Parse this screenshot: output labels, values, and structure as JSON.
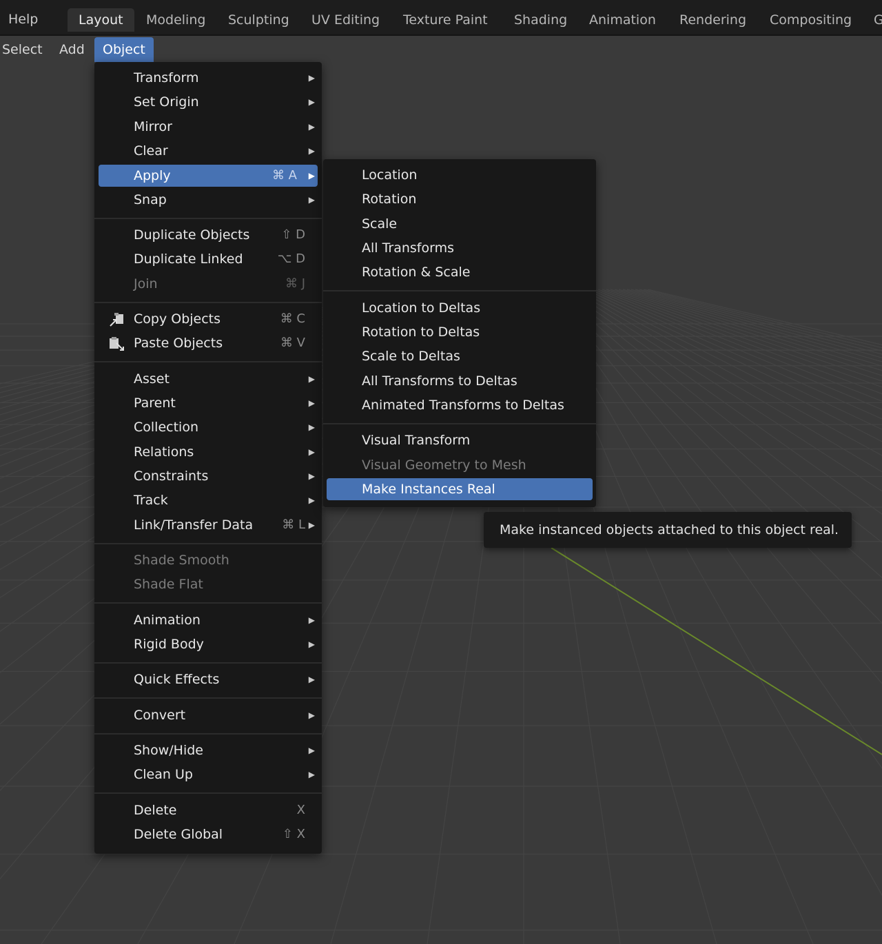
{
  "topbar": {
    "help": "Help",
    "tabs": [
      "Layout",
      "Modeling",
      "Sculpting",
      "UV Editing",
      "Texture Paint",
      "Shading",
      "Animation",
      "Rendering",
      "Compositing",
      "G"
    ]
  },
  "menubar": {
    "select": "Select",
    "add": "Add",
    "object": "Object"
  },
  "object_menu": {
    "transform": "Transform",
    "set_origin": "Set Origin",
    "mirror": "Mirror",
    "clear": "Clear",
    "apply": "Apply",
    "apply_shortcut": "⌘ A",
    "snap": "Snap",
    "duplicate_objects": "Duplicate Objects",
    "duplicate_objects_shortcut": "⇧ D",
    "duplicate_linked": "Duplicate Linked",
    "duplicate_linked_shortcut": "⌥ D",
    "join": "Join",
    "join_shortcut": "⌘ J",
    "copy_objects": "Copy Objects",
    "copy_objects_shortcut": "⌘ C",
    "paste_objects": "Paste Objects",
    "paste_objects_shortcut": "⌘ V",
    "asset": "Asset",
    "parent": "Parent",
    "collection": "Collection",
    "relations": "Relations",
    "constraints": "Constraints",
    "track": "Track",
    "link_transfer": "Link/Transfer Data",
    "link_transfer_shortcut": "⌘ L",
    "shade_smooth": "Shade Smooth",
    "shade_flat": "Shade Flat",
    "animation": "Animation",
    "rigid_body": "Rigid Body",
    "quick_effects": "Quick Effects",
    "convert": "Convert",
    "show_hide": "Show/Hide",
    "clean_up": "Clean Up",
    "delete": "Delete",
    "delete_shortcut": "X",
    "delete_global": "Delete Global",
    "delete_global_shortcut": "⇧ X"
  },
  "apply_submenu": {
    "location": "Location",
    "rotation": "Rotation",
    "scale": "Scale",
    "all_transforms": "All Transforms",
    "rotation_scale": "Rotation & Scale",
    "location_deltas": "Location to Deltas",
    "rotation_deltas": "Rotation to Deltas",
    "scale_deltas": "Scale to Deltas",
    "all_transforms_deltas": "All Transforms to Deltas",
    "animated_transforms_deltas": "Animated Transforms to Deltas",
    "visual_transform": "Visual Transform",
    "visual_geometry_mesh": "Visual Geometry to Mesh",
    "make_instances_real": "Make Instances Real"
  },
  "tooltip": "Make instanced objects attached to this object real.",
  "colors": {
    "accent": "#4772b3",
    "menu_bg": "#181818",
    "viewport_bg": "#3a3a3a"
  }
}
